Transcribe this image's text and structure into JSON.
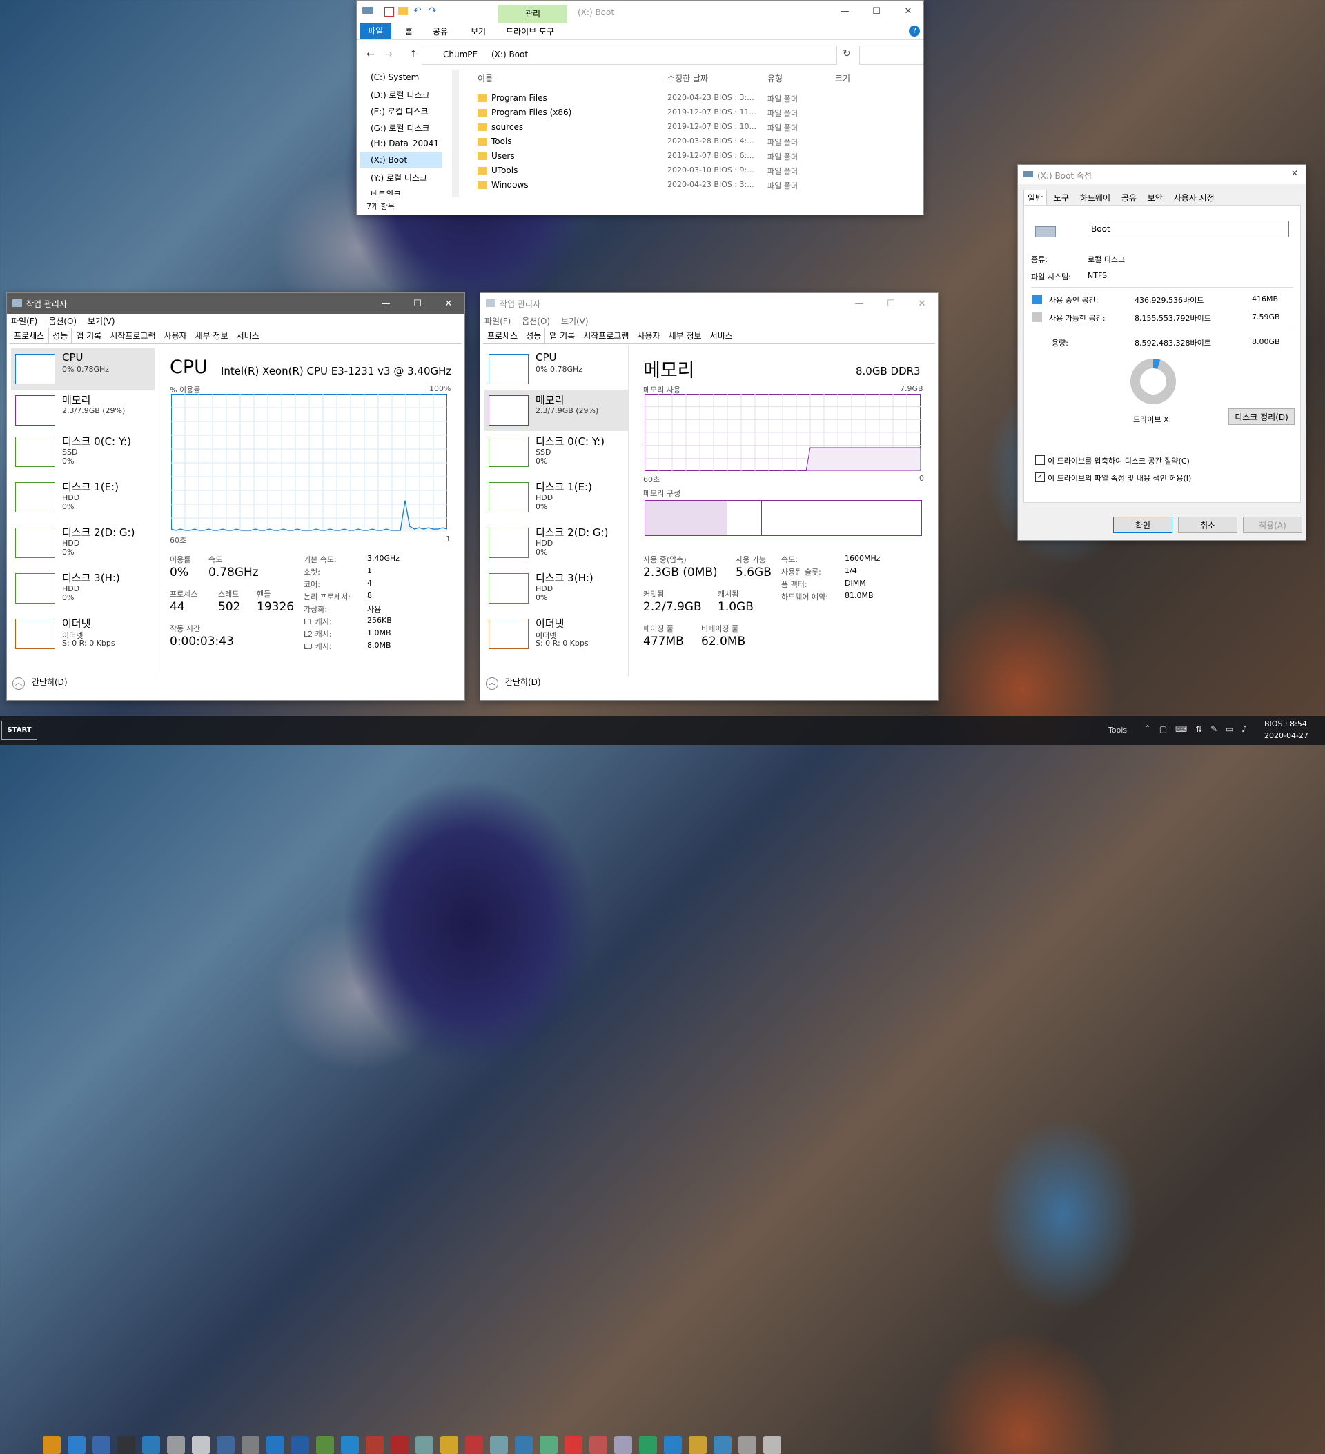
{
  "explorer": {
    "tab_manage": "관리",
    "title": "(X:) Boot",
    "ribbon_tabs": [
      "파일",
      "홈",
      "공유",
      "보기",
      "드라이브 도구"
    ],
    "breadcrumb": [
      "ChumPE",
      "(X:) Boot"
    ],
    "columns": [
      "이름",
      "수정한 날짜",
      "유형",
      "크기"
    ],
    "tree": [
      "(C:) System",
      "(D:) 로컬 디스크",
      "(E:) 로컬 디스크",
      "(G:) 로컬 디스크",
      "(H:) Data_20041",
      "(X:) Boot",
      "(Y:) 로컬 디스크",
      "네트워크"
    ],
    "files": [
      {
        "name": "Program Files",
        "date": "2020-04-23 BIOS : 3:...",
        "type": "파일 폴더"
      },
      {
        "name": "Program Files (x86)",
        "date": "2019-12-07 BIOS : 11...",
        "type": "파일 폴더"
      },
      {
        "name": "sources",
        "date": "2019-12-07 BIOS : 10...",
        "type": "파일 폴더"
      },
      {
        "name": "Tools",
        "date": "2020-03-28 BIOS : 4:...",
        "type": "파일 폴더"
      },
      {
        "name": "Users",
        "date": "2019-12-07 BIOS : 6:...",
        "type": "파일 폴더"
      },
      {
        "name": "UTools",
        "date": "2020-03-10 BIOS : 9:...",
        "type": "파일 폴더"
      },
      {
        "name": "Windows",
        "date": "2020-04-23 BIOS : 3:...",
        "type": "파일 폴더"
      }
    ],
    "status": "7개 항목"
  },
  "props": {
    "title": "(X:) Boot 속성",
    "tabs": [
      "일반",
      "도구",
      "하드웨어",
      "공유",
      "보안",
      "사용자 지정"
    ],
    "name_value": "Boot",
    "type_label": "종류:",
    "type_value": "로컬 디스크",
    "fs_label": "파일 시스템:",
    "fs_value": "NTFS",
    "used_label": "사용 중인 공간:",
    "used_bytes": "436,929,536바이트",
    "used_size": "416MB",
    "free_label": "사용 가능한 공간:",
    "free_bytes": "8,155,553,792바이트",
    "free_size": "7.59GB",
    "cap_label": "용량:",
    "cap_bytes": "8,592,483,328바이트",
    "cap_size": "8.00GB",
    "drive_label": "드라이브 X:",
    "cleanup": "디스크 정리(D)",
    "compress": "이 드라이브를 압축하여 디스크 공간 절약(C)",
    "index": "이 드라이브의 파일 속성 및 내용 색인 허용(I)",
    "ok": "확인",
    "cancel": "취소",
    "apply": "적용(A)",
    "used_color": "#2e8ee0",
    "free_color": "#c8c8c8",
    "used_fraction": 0.0509
  },
  "tm_common": {
    "title": "작업 관리자",
    "menu": [
      "파일(F)",
      "옵션(O)",
      "보기(V)"
    ],
    "tabs": [
      "프로세스",
      "성능",
      "앱 기록",
      "시작프로그램",
      "사용자",
      "세부 정보",
      "서비스"
    ],
    "collapse": "간단히(D)",
    "side": [
      {
        "t1": "CPU",
        "t2": "0% 0.78GHz",
        "t3": ""
      },
      {
        "t1": "메모리",
        "t2": "2.3/7.9GB (29%)",
        "t3": ""
      },
      {
        "t1": "디스크 0(C: Y:)",
        "t2": "SSD",
        "t3": "0%"
      },
      {
        "t1": "디스크 1(E:)",
        "t2": "HDD",
        "t3": "0%"
      },
      {
        "t1": "디스크 2(D: G:)",
        "t2": "HDD",
        "t3": "0%"
      },
      {
        "t1": "디스크 3(H:)",
        "t2": "HDD",
        "t3": "0%"
      },
      {
        "t1": "이더넷",
        "t2": "이더넷",
        "t3": "S: 0 R: 0 Kbps"
      }
    ]
  },
  "tm_cpu": {
    "heading": "CPU",
    "model": "Intel(R) Xeon(R) CPU E3-1231 v3 @ 3.40GHz",
    "axis_label": "% 이용률",
    "axis_max": "100%",
    "axis_left": "60초",
    "axis_right": "1",
    "util_label": "이용률",
    "util": "0%",
    "speed_label": "속도",
    "speed": "0.78GHz",
    "proc_label": "프로세스",
    "proc": "44",
    "thread_label": "스레드",
    "thread": "502",
    "handle_label": "핸들",
    "handle": "19326",
    "uptime_label": "작동 시간",
    "uptime": "0:00:03:43",
    "specs": [
      {
        "k": "기본 속도:",
        "v": "3.40GHz"
      },
      {
        "k": "소켓:",
        "v": "1"
      },
      {
        "k": "코어:",
        "v": "4"
      },
      {
        "k": "논리 프로세서:",
        "v": "8"
      },
      {
        "k": "가상화:",
        "v": "사용"
      },
      {
        "k": "L1 캐시:",
        "v": "256KB"
      },
      {
        "k": "L2 캐시:",
        "v": "1.0MB"
      },
      {
        "k": "L3 캐시:",
        "v": "8.0MB"
      }
    ],
    "chart_data": {
      "type": "line",
      "ylim": [
        0,
        100
      ],
      "values": [
        1,
        0,
        1,
        0,
        0,
        1,
        0,
        0,
        1,
        0,
        0,
        1,
        0,
        0,
        1,
        0,
        0,
        0,
        1,
        0,
        0,
        1,
        0,
        0,
        1,
        0,
        0,
        1,
        0,
        0,
        0,
        1,
        0,
        0,
        1,
        0,
        0,
        1,
        0,
        0,
        1,
        0,
        0,
        1,
        0,
        0,
        1,
        0,
        0,
        0,
        22,
        3,
        1,
        2,
        1,
        2,
        1,
        1,
        2,
        1
      ]
    }
  },
  "tm_mem": {
    "heading": "메모리",
    "capacity": "8.0GB DDR3",
    "axis_label": "메모리 사용",
    "axis_max": "7.9GB",
    "axis_left": "60초",
    "axis_right": "0",
    "comp_label": "메모리 구성",
    "inuse_label": "사용 중(압축)",
    "inuse": "2.3GB (0MB)",
    "avail_label": "사용 가능",
    "avail": "5.6GB",
    "commit_label": "커밋됨",
    "commit": "2.2/7.9GB",
    "cached_label": "캐시됨",
    "cached": "1.0GB",
    "paged_label": "페이징 풀",
    "paged": "477MB",
    "nonpaged_label": "비페이징 풀",
    "nonpaged": "62.0MB",
    "specs": [
      {
        "k": "속도:",
        "v": "1600MHz"
      },
      {
        "k": "사용된 슬롯:",
        "v": "1/4"
      },
      {
        "k": "폼 팩터:",
        "v": "DIMM"
      },
      {
        "k": "하드웨어 예약:",
        "v": "81.0MB"
      }
    ]
  },
  "taskbar": {
    "start": "START",
    "tools": "Tools",
    "time": "BIOS : 8:54",
    "date": "2020-04-27"
  }
}
